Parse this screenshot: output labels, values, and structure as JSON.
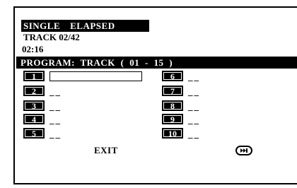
{
  "status": {
    "mode": "SINGLE",
    "time_mode": "ELAPSED",
    "track": "TRACK 02/42",
    "time": "02:16"
  },
  "program": {
    "title": "PROGRAM:  TRACK ( 01 - 15 )",
    "left_slots": [
      {
        "number": "1",
        "value": ""
      },
      {
        "number": "2",
        "value": "__"
      },
      {
        "number": "3",
        "value": "__"
      },
      {
        "number": "4",
        "value": "__"
      },
      {
        "number": "5",
        "value": "__"
      }
    ],
    "right_slots": [
      {
        "number": "6",
        "value": "__"
      },
      {
        "number": "7",
        "value": "__"
      },
      {
        "number": "8",
        "value": "__"
      },
      {
        "number": "9",
        "value": "__"
      },
      {
        "number": "10",
        "value": "__"
      }
    ]
  },
  "footer": {
    "exit_label": "EXIT",
    "play_icon": "skip-play-icon"
  },
  "colors": {
    "background": "#ffffff",
    "ink": "#000000"
  }
}
